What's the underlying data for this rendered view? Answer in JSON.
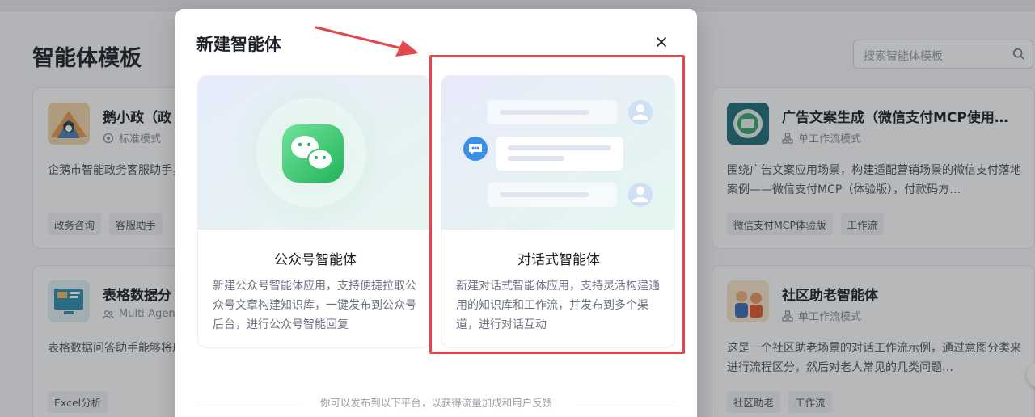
{
  "page": {
    "title": "智能体模板",
    "search_placeholder": "搜索智能体模板"
  },
  "cards": [
    {
      "name": "鹅小政（政",
      "mode": "标准模式",
      "desc": "企鹅市智能政务客服助手，帮助您解答各类政务服务相关",
      "tags": [
        "政务咨询",
        "客服助手"
      ]
    },
    {
      "name": "广告文案生成（微信支付MCP使用…",
      "mode": "单工作流模式",
      "desc": "围绕广告文案应用场景，构建适配营销场景的微信支付落地案例——微信支付MCP（体验版），付款码方…",
      "tags": [
        "微信支付MCP体验版",
        "工作流"
      ]
    },
    {
      "name": "表格数据分",
      "mode": "Multi-Agen",
      "desc": "表格数据问答助手能够将用户上传的Excel自动总结内容",
      "tags": [
        "Excel分析"
      ]
    },
    {
      "name": "社区助老智能体",
      "mode": "单工作流模式",
      "desc": "这是一个社区助老场景的对话工作流示例，通过意图分类来进行流程区分，然后对老人常见的几类问题…",
      "tags": [
        "社区助老",
        "工作流"
      ]
    }
  ],
  "modal": {
    "title": "新建智能体",
    "options": [
      {
        "title": "公众号智能体",
        "desc": "新建公众号智能体应用，支持便捷拉取公众号文章构建知识库，一键发布到公众号后台，进行公众号智能回复"
      },
      {
        "title": "对话式智能体",
        "desc": "新建对话式智能体应用，支持灵活构建通用的知识库和工作流，并发布到多个渠道，进行对话互动"
      }
    ],
    "footer_note": "你可以发布到以下平台，以获得流量加成和用户反馈"
  },
  "colors": {
    "highlight": "#e2484b",
    "wechat_green": "#2fc25b",
    "chat_blue": "#3a8ee6"
  }
}
